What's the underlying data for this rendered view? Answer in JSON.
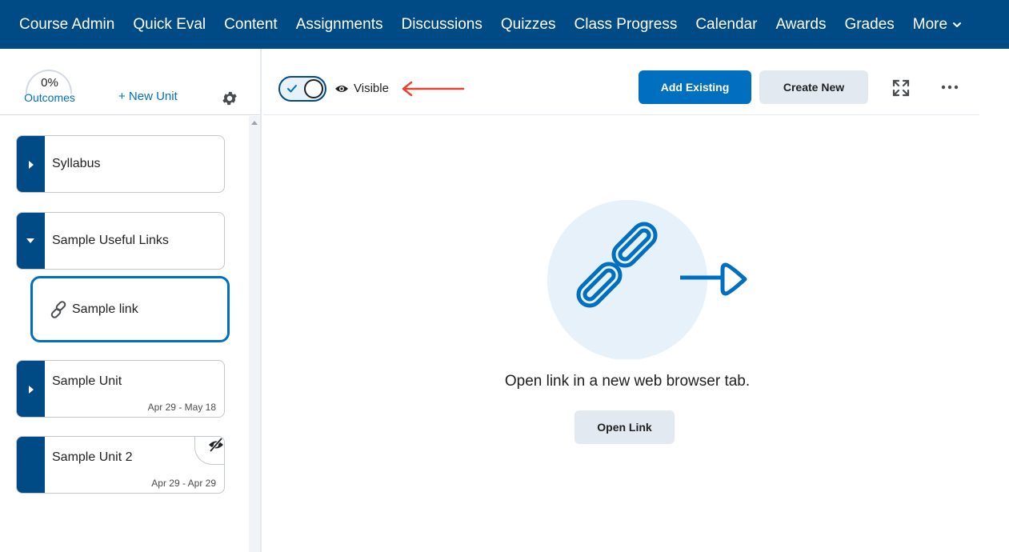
{
  "nav": {
    "items": [
      "Course Admin",
      "Quick Eval",
      "Content",
      "Assignments",
      "Discussions",
      "Quizzes",
      "Class Progress",
      "Calendar",
      "Awards",
      "Grades"
    ],
    "more_label": "More",
    "background": "#004b85"
  },
  "sidebar": {
    "outcomes_percent": "0%",
    "outcomes_label": "Outcomes",
    "new_unit_label": "+ New Unit",
    "units": [
      {
        "title": "Syllabus",
        "dates": "",
        "expanded": false
      },
      {
        "title": "Sample Useful Links",
        "dates": "",
        "expanded": true
      },
      {
        "title": "Sample Unit",
        "dates": "Apr 29 - May 18",
        "expanded": false
      },
      {
        "title": "Sample Unit 2",
        "dates": "Apr 29 - Apr 29",
        "expanded": false,
        "hidden": true
      }
    ],
    "selected_item": {
      "title": "Sample link",
      "icon": "link-icon"
    }
  },
  "toolbar": {
    "visibility_on": true,
    "visibility_label": "Visible",
    "add_existing_label": "Add Existing",
    "create_new_label": "Create New"
  },
  "content": {
    "message": "Open link in a new web browser tab.",
    "open_link_label": "Open Link"
  },
  "colors": {
    "brand": "#004b85",
    "primary": "#006fbf",
    "annotation_arrow": "#e8412f",
    "illustration_bg": "#e6f1fa"
  }
}
